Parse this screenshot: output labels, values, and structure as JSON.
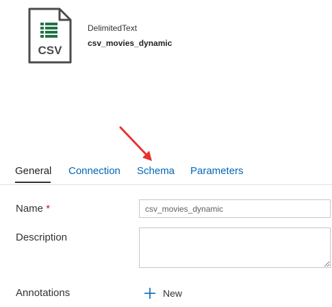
{
  "header": {
    "icon_label": "CSV",
    "dataset_type": "DelimitedText",
    "dataset_name": "csv_movies_dynamic"
  },
  "tabs": [
    {
      "label": "General",
      "active": true
    },
    {
      "label": "Connection",
      "active": false
    },
    {
      "label": "Schema",
      "active": false
    },
    {
      "label": "Parameters",
      "active": false
    }
  ],
  "form": {
    "name_label": "Name",
    "required_marker": "*",
    "name_value": "csv_movies_dynamic",
    "description_label": "Description",
    "description_value": "",
    "annotations_label": "Annotations",
    "new_button_label": "New"
  },
  "annotation": {
    "arrow_color": "#e8312f",
    "points_to": "Schema"
  },
  "colors": {
    "link": "#0066b8",
    "icon_green": "#217346",
    "icon_gray": "#505050"
  }
}
